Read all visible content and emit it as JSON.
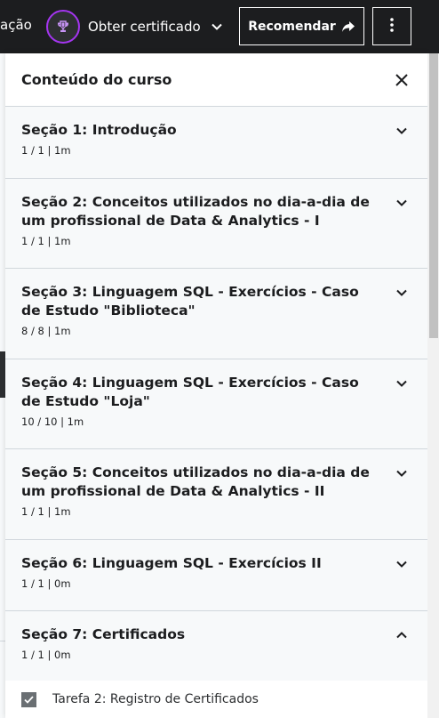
{
  "topbar": {
    "cut_text": "ação",
    "certificate_label": "Obter certificado",
    "recommend_label": "Recomendar"
  },
  "panel": {
    "title": "Conteúdo do curso",
    "sections": [
      {
        "title": "Seção 1: Introdução",
        "meta": "1 / 1 | 1m",
        "expanded": false
      },
      {
        "title": "Seção 2: Conceitos utilizados no dia-a-dia de um profissional de Data & Analytics - I",
        "meta": "1 / 1 | 1m",
        "expanded": false
      },
      {
        "title": "Seção 3: Linguagem SQL - Exercícios - Caso de Estudo \"Biblioteca\"",
        "meta": "8 / 8 | 1m",
        "expanded": false
      },
      {
        "title": "Seção 4: Linguagem SQL - Exercícios - Caso de Estudo \"Loja\"",
        "meta": "10 / 10 | 1m",
        "expanded": false
      },
      {
        "title": "Seção 5: Conceitos utilizados no dia-a-dia de um profissional de Data & Analytics - II",
        "meta": "1 / 1 | 1m",
        "expanded": false
      },
      {
        "title": "Seção 6: Linguagem SQL - Exercícios II",
        "meta": "1 / 1 | 0m",
        "expanded": false
      },
      {
        "title": "Seção 7: Certificados",
        "meta": "1 / 1 | 0m",
        "expanded": true
      }
    ],
    "lecture": {
      "label": "Tarefa 2: Registro de Certificados",
      "checked": true
    }
  },
  "colors": {
    "topbar_bg": "#1c1d1f",
    "accent_purple": "#a435f0",
    "section_bg": "#f7f9fa",
    "divider": "#d1d7dc"
  },
  "icons": [
    "trophy-icon",
    "chevron-down-icon",
    "share-arrow-icon",
    "more-vertical-icon",
    "close-icon",
    "chevron-up-icon",
    "check-icon"
  ]
}
